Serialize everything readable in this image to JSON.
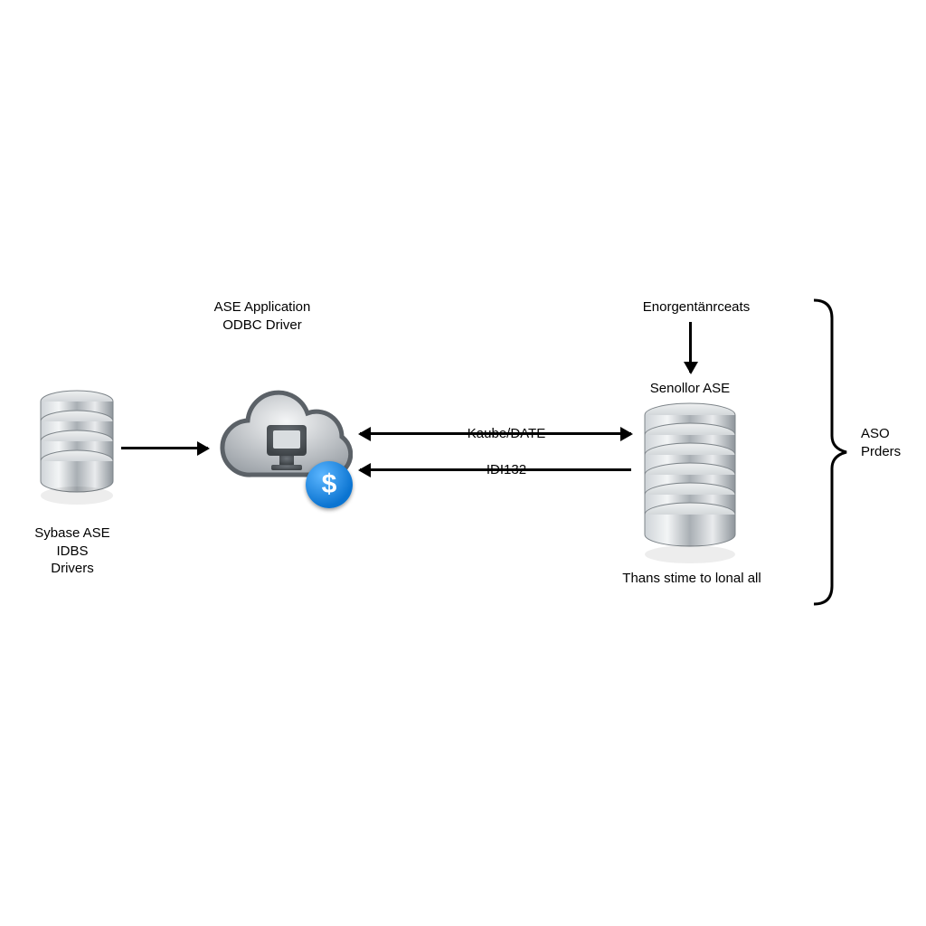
{
  "labels": {
    "ase_application_odbc_driver": "ASE Application\nODBC Driver",
    "enorgent": "Enorgentänrceats",
    "senollor_ase": "Senollor ASE",
    "kaube_date": "Kaube/DATE",
    "idi132": "IDI132",
    "thans_stime": "Thans stime to lonal all",
    "sybase_ase_idbs_drivers": "Sybase ASE\nIDBS\nDrivers",
    "aso_prders": "ASO\nPrders"
  },
  "icons": {
    "db_small": "database-icon",
    "db_large": "database-icon",
    "cloud": "cloud-app-icon",
    "dollar": "dollar-badge-icon"
  },
  "dollar_symbol": "$"
}
